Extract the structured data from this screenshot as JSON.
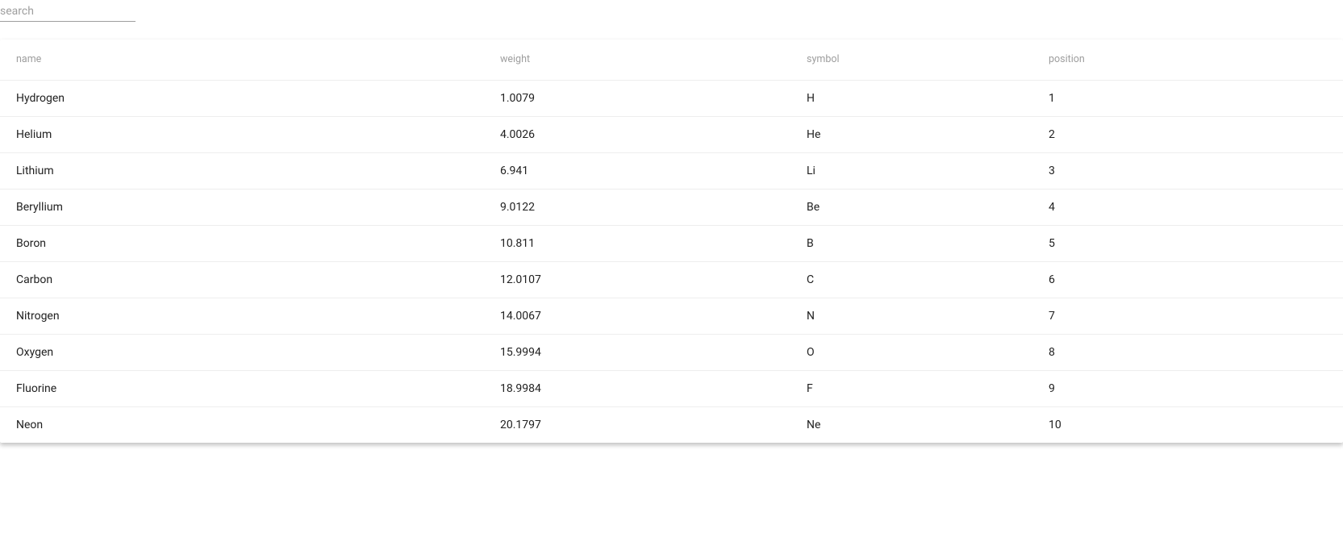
{
  "search": {
    "placeholder": "search",
    "value": ""
  },
  "table": {
    "columns": {
      "name": "name",
      "weight": "weight",
      "symbol": "symbol",
      "position": "position"
    },
    "rows": [
      {
        "name": "Hydrogen",
        "weight": "1.0079",
        "symbol": "H",
        "position": "1"
      },
      {
        "name": "Helium",
        "weight": "4.0026",
        "symbol": "He",
        "position": "2"
      },
      {
        "name": "Lithium",
        "weight": "6.941",
        "symbol": "Li",
        "position": "3"
      },
      {
        "name": "Beryllium",
        "weight": "9.0122",
        "symbol": "Be",
        "position": "4"
      },
      {
        "name": "Boron",
        "weight": "10.811",
        "symbol": "B",
        "position": "5"
      },
      {
        "name": "Carbon",
        "weight": "12.0107",
        "symbol": "C",
        "position": "6"
      },
      {
        "name": "Nitrogen",
        "weight": "14.0067",
        "symbol": "N",
        "position": "7"
      },
      {
        "name": "Oxygen",
        "weight": "15.9994",
        "symbol": "O",
        "position": "8"
      },
      {
        "name": "Fluorine",
        "weight": "18.9984",
        "symbol": "F",
        "position": "9"
      },
      {
        "name": "Neon",
        "weight": "20.1797",
        "symbol": "Ne",
        "position": "10"
      }
    ]
  }
}
